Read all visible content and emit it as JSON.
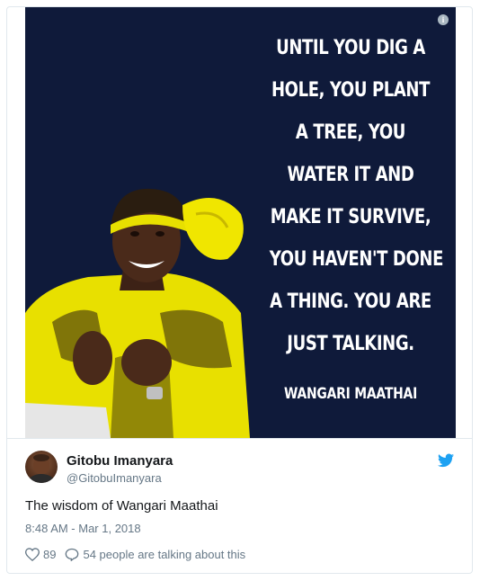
{
  "media": {
    "quote_lines": [
      "UNTIL YOU DIG A",
      "HOLE, YOU PLANT",
      "A TREE, YOU",
      "WATER IT AND",
      "MAKE IT SURVIVE,",
      "YOU HAVEN'T DONE",
      "A THING. YOU ARE",
      "JUST TALKING."
    ],
    "author": "WANGARI MAATHAI",
    "background_color": "#0f1a3a",
    "info_icon": "info-icon"
  },
  "tweet": {
    "display_name": "Gitobu Imanyara",
    "handle": "@GitobuImanyara",
    "text": "The wisdom of Wangari Maathai",
    "timestamp": "8:48 AM - Mar 1, 2018",
    "likes": "89",
    "replies_label": "54 people are talking about this",
    "brand_color": "#1da1f2"
  }
}
